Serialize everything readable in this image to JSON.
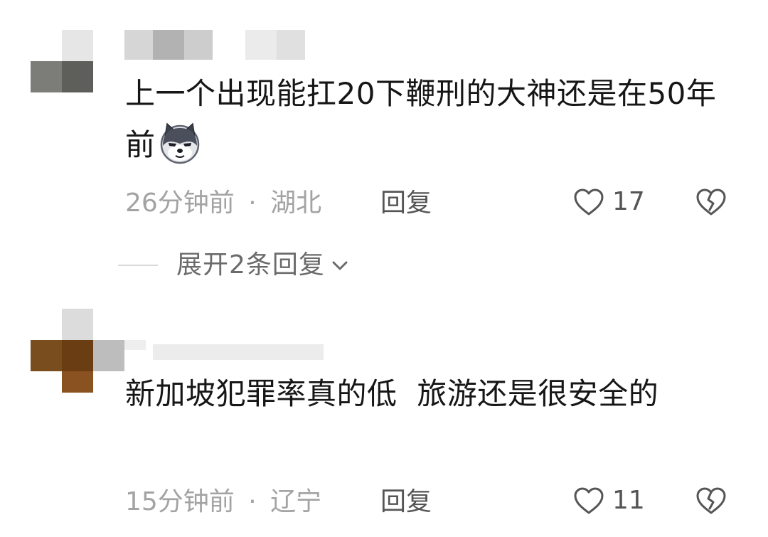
{
  "comments": [
    {
      "text": "上一个出现能扛20下鞭刑的大神还是在50年前",
      "emoji": "husky-dog-face-emoji",
      "time": "26分钟前",
      "location": "湖北",
      "reply_label": "回复",
      "likes": "17",
      "expand_label": "展开2条回复"
    },
    {
      "text": "新加坡犯罪率真的低  旅游还是很安全的",
      "time": "15分钟前",
      "location": "辽宁",
      "reply_label": "回复",
      "likes": "11"
    }
  ],
  "meta_separator": "·",
  "icons": {
    "like": "heart-outline-icon",
    "dislike": "broken-heart-icon",
    "expand": "chevron-down-icon"
  },
  "colors": {
    "text": "#161616",
    "meta": "#a3a3a3",
    "action": "#555555"
  }
}
